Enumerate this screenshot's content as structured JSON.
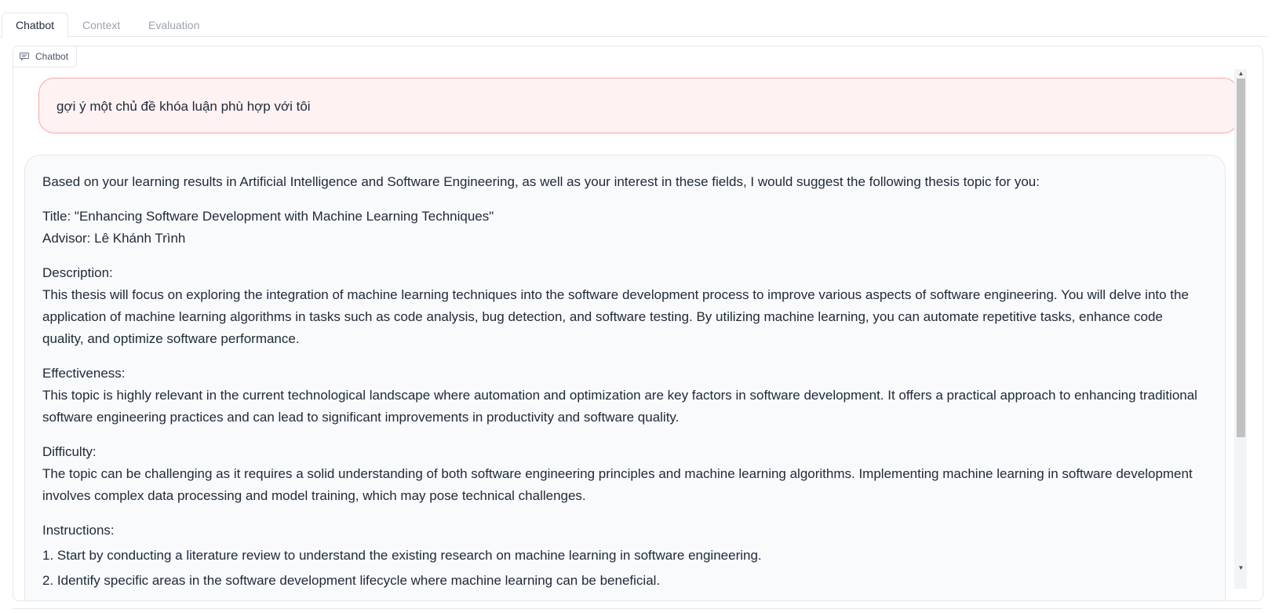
{
  "tabs": [
    {
      "label": "Chatbot",
      "active": true
    },
    {
      "label": "Context",
      "active": false
    },
    {
      "label": "Evaluation",
      "active": false
    }
  ],
  "panel": {
    "label": "Chatbot",
    "icon": "chat-icon"
  },
  "messages": {
    "user": {
      "text": "gợi ý một chủ đề khóa luận phù hợp với tôi",
      "bubble_color": "#fef2f2",
      "border_color": "#fca5a5"
    },
    "bot": {
      "bubble_color": "#f8fafc",
      "intro": "Based on your learning results in Artificial Intelligence and Software Engineering, as well as your interest in these fields, I would suggest the following thesis topic for you:",
      "title_line": "Title: \"Enhancing Software Development with Machine Learning Techniques\"",
      "advisor_line": "Advisor: Lê Khánh Trình",
      "description_heading": "Description:",
      "description_text": "This thesis will focus on exploring the integration of machine learning techniques into the software development process to improve various aspects of software engineering. You will delve into the application of machine learning algorithms in tasks such as code analysis, bug detection, and software testing. By utilizing machine learning, you can automate repetitive tasks, enhance code quality, and optimize software performance.",
      "effectiveness_heading": "Effectiveness:",
      "effectiveness_text": "This topic is highly relevant in the current technological landscape where automation and optimization are key factors in software development. It offers a practical approach to enhancing traditional software engineering practices and can lead to significant improvements in productivity and software quality.",
      "difficulty_heading": "Difficulty:",
      "difficulty_text": "The topic can be challenging as it requires a solid understanding of both software engineering principles and machine learning algorithms. Implementing machine learning in software development involves complex data processing and model training, which may pose technical challenges.",
      "instructions_heading": "Instructions:",
      "instruction_1": "1. Start by conducting a literature review to understand the existing research on machine learning in software engineering.",
      "instruction_2": "2. Identify specific areas in the software development lifecycle where machine learning can be beneficial."
    }
  }
}
